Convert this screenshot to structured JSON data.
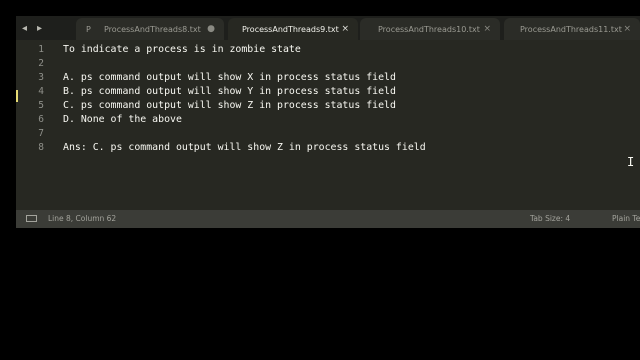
{
  "tabs": [
    {
      "prefix": "P",
      "label": "ProcessAndThreads8.txt",
      "indicator": "●",
      "active": false
    },
    {
      "label": "ProcessAndThreads9.txt",
      "close": "×",
      "active": true
    },
    {
      "label": "ProcessAndThreads10.txt",
      "close": "×",
      "active": false
    },
    {
      "label": "ProcessAndThreads11.txt",
      "close": "×",
      "active": false
    }
  ],
  "nav": {
    "left": "◂",
    "right": "▸"
  },
  "editor": {
    "lines": [
      {
        "no": "1",
        "text": "To indicate a process is in zombie state"
      },
      {
        "no": "2",
        "text": ""
      },
      {
        "no": "3",
        "text": "A. ps command output will show X in process status field"
      },
      {
        "no": "4",
        "text": "B. ps command output will show Y in process status field"
      },
      {
        "no": "5",
        "text": "C. ps command output will show Z in process status field"
      },
      {
        "no": "6",
        "text": "D. None of the above"
      },
      {
        "no": "7",
        "text": ""
      },
      {
        "no": "8",
        "text": "Ans: C. ps command output will show Z in process status field"
      }
    ],
    "cursor_glyph": "I"
  },
  "status": {
    "position": "Line 8, Column 62",
    "tab_size": "Tab Size: 4",
    "syntax": "Plain Te"
  },
  "colors": {
    "editor_bg": "#272822",
    "tabbar_bg": "#1e1f1c",
    "status_bg": "#3b3c37",
    "text": "#f8f8f2",
    "line_number": "#8f908a"
  }
}
